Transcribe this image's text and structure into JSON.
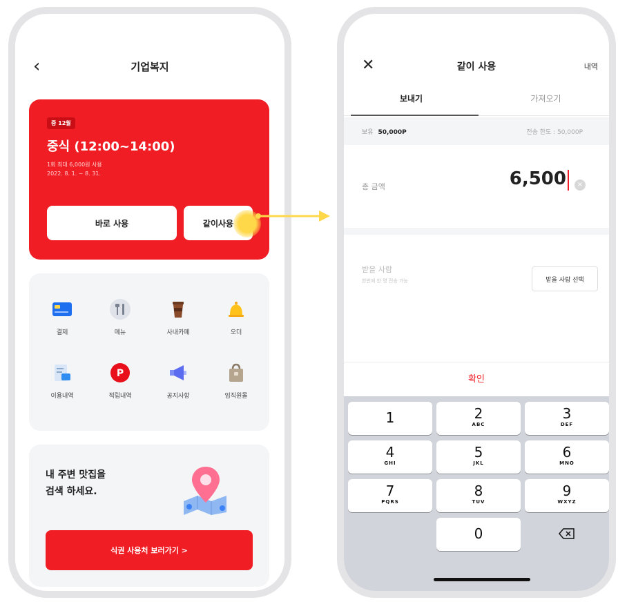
{
  "left_screen": {
    "title": "기업복지",
    "meal_card": {
      "badge": "중 12월",
      "title": "중식 (12:00~14:00)",
      "desc_line1": "1회 최대 6,000원 사용",
      "desc_line2": "2022. 8. 1. ~ 8. 31.",
      "use_button": "바로 사용",
      "share_button": "같이사용"
    },
    "menu": [
      {
        "label": "결제",
        "icon": "card-icon"
      },
      {
        "label": "메뉴",
        "icon": "fork-knife-icon"
      },
      {
        "label": "사내카페",
        "icon": "coffee-cup-icon"
      },
      {
        "label": "오더",
        "icon": "bell-icon"
      },
      {
        "label": "이용내역",
        "icon": "receipt-icon"
      },
      {
        "label": "적립내역",
        "icon": "point-icon"
      },
      {
        "label": "공지사항",
        "icon": "megaphone-icon"
      },
      {
        "label": "임직원몰",
        "icon": "shopping-bag-icon"
      }
    ],
    "restaurant": {
      "line1": "내 주변 맛집을",
      "line2": "검색 하세요.",
      "button": "식권 사용처 보러가기 >"
    }
  },
  "right_screen": {
    "title": "같이 사용",
    "history_link": "내역",
    "tabs": [
      "보내기",
      "가져오기"
    ],
    "balance_label": "보유",
    "balance_value": "50,000P",
    "limit_text": "전송 한도 : 50,000P",
    "amount_label": "총 금액",
    "amount_value": "6,500",
    "recipient_label": "받을 사람",
    "recipient_hint": "한번에 한 명 전송 가능",
    "recipient_button": "받을 사람 선택",
    "confirm": "확인",
    "keypad": [
      {
        "num": "1",
        "sub": ""
      },
      {
        "num": "2",
        "sub": "ABC"
      },
      {
        "num": "3",
        "sub": "DEF"
      },
      {
        "num": "4",
        "sub": "GHI"
      },
      {
        "num": "5",
        "sub": "JKL"
      },
      {
        "num": "6",
        "sub": "MNO"
      },
      {
        "num": "7",
        "sub": "PQRS"
      },
      {
        "num": "8",
        "sub": "TUV"
      },
      {
        "num": "9",
        "sub": "WXYZ"
      },
      {
        "num": "0",
        "sub": ""
      }
    ]
  },
  "colors": {
    "brand_red": "#f01d24",
    "highlight_yellow": "#ffd84a",
    "surface_gray": "#f4f5f7",
    "keypad_gray": "#d1d4da"
  }
}
